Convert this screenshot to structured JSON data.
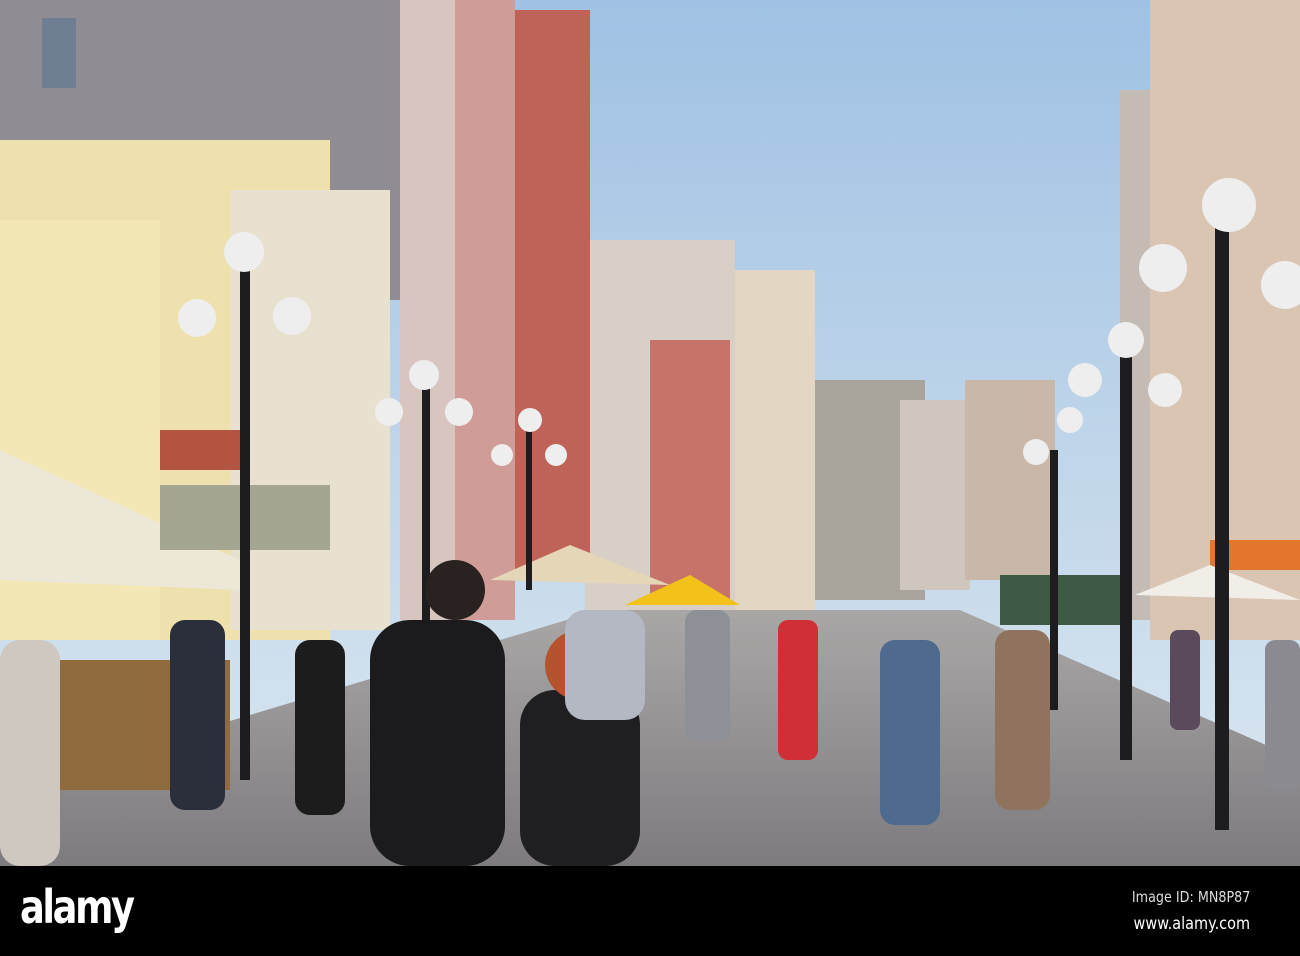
{
  "footer": {
    "logo": "alamy",
    "image_id": "Image ID: MN8P87",
    "url": "www.alamy.com"
  },
  "colors": {
    "sky": "#b9d3ea",
    "pavement": "#8e8c8f",
    "footer": "#000000"
  }
}
